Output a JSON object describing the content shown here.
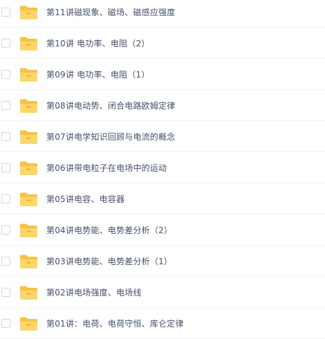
{
  "colors": {
    "folder_back": "#f6c342",
    "folder_front": "#fbd66b",
    "folder_tab_clip": "#f0b429",
    "text": "#424e67",
    "row_divider": "#f1f2f4"
  },
  "file_list": {
    "items": [
      {
        "name": "第11讲磁现象、磁场、磁感应强度",
        "type": "folder",
        "icon": "folder-icon"
      },
      {
        "name": "第10讲 电功率、电阻（2）",
        "type": "folder",
        "icon": "folder-icon"
      },
      {
        "name": "第09讲 电功率、电阻（1）",
        "type": "folder",
        "icon": "folder-icon"
      },
      {
        "name": "第08讲电动势、闭合电路欧姆定律",
        "type": "folder",
        "icon": "folder-icon"
      },
      {
        "name": "第07讲电学知识回顾与电流的概念",
        "type": "folder",
        "icon": "folder-icon"
      },
      {
        "name": "第06讲带电粒子在电场中的运动",
        "type": "folder",
        "icon": "folder-icon"
      },
      {
        "name": "第05讲电容、电容器",
        "type": "folder",
        "icon": "folder-icon"
      },
      {
        "name": "第04讲电势能、电势差分析（2）",
        "type": "folder",
        "icon": "folder-icon"
      },
      {
        "name": "第03讲电势能、电势差分析（1）",
        "type": "folder",
        "icon": "folder-icon"
      },
      {
        "name": "第02讲电场强度、电场线",
        "type": "folder",
        "icon": "folder-icon"
      },
      {
        "name": "第01讲：电荷、电荷守恒、库仑定律",
        "type": "folder",
        "icon": "folder-icon"
      }
    ]
  }
}
